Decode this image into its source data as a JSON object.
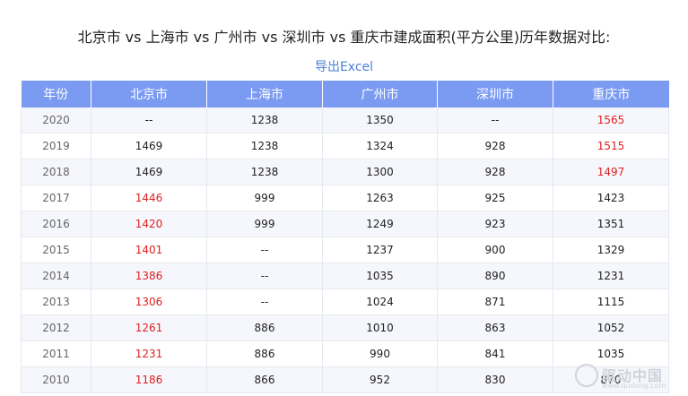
{
  "title": "北京市 vs 上海市 vs 广州市 vs 深圳市 vs 重庆市建成面积(平方公里)历年数据对比:",
  "export_label": "导出Excel",
  "table": {
    "headers": [
      "年份",
      "北京市",
      "上海市",
      "广州市",
      "深圳市",
      "重庆市"
    ],
    "rows": [
      {
        "cells": [
          "2020",
          "--",
          "1238",
          "1350",
          "--",
          "1565"
        ],
        "highlight": [
          5
        ]
      },
      {
        "cells": [
          "2019",
          "1469",
          "1238",
          "1324",
          "928",
          "1515"
        ],
        "highlight": [
          5
        ]
      },
      {
        "cells": [
          "2018",
          "1469",
          "1238",
          "1300",
          "928",
          "1497"
        ],
        "highlight": [
          5
        ]
      },
      {
        "cells": [
          "2017",
          "1446",
          "999",
          "1263",
          "925",
          "1423"
        ],
        "highlight": [
          1
        ]
      },
      {
        "cells": [
          "2016",
          "1420",
          "999",
          "1249",
          "923",
          "1351"
        ],
        "highlight": [
          1
        ]
      },
      {
        "cells": [
          "2015",
          "1401",
          "--",
          "1237",
          "900",
          "1329"
        ],
        "highlight": [
          1
        ]
      },
      {
        "cells": [
          "2014",
          "1386",
          "--",
          "1035",
          "890",
          "1231"
        ],
        "highlight": [
          1
        ]
      },
      {
        "cells": [
          "2013",
          "1306",
          "--",
          "1024",
          "871",
          "1115"
        ],
        "highlight": [
          1
        ]
      },
      {
        "cells": [
          "2012",
          "1261",
          "886",
          "1010",
          "863",
          "1052"
        ],
        "highlight": [
          1
        ]
      },
      {
        "cells": [
          "2011",
          "1231",
          "886",
          "990",
          "841",
          "1035"
        ],
        "highlight": [
          1
        ]
      },
      {
        "cells": [
          "2010",
          "1186",
          "866",
          "952",
          "830",
          "870"
        ],
        "highlight": [
          1
        ]
      }
    ]
  },
  "watermark": {
    "text": "驱动中国",
    "url": "www.qudong.com"
  },
  "colors": {
    "header_bg": "#7b9bf2",
    "highlight": "#e02020",
    "link": "#4a7fd6"
  }
}
